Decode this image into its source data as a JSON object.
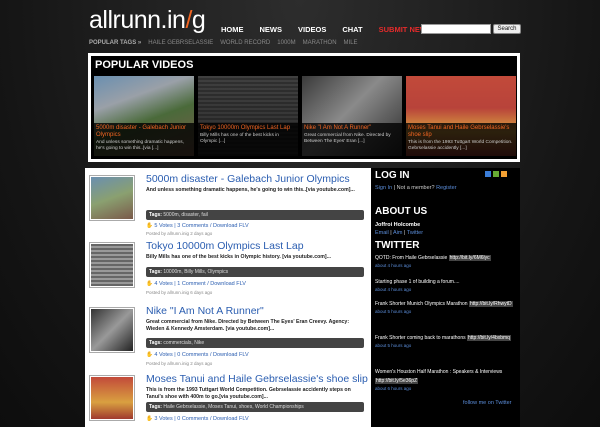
{
  "brand": {
    "logo_left": "allrunn.in",
    "logo_slash": "/",
    "logo_right": "g"
  },
  "nav": {
    "home": "HOME",
    "news": "NEWS",
    "videos": "VIDEOS",
    "chat": "CHAT",
    "submit": "SUBMIT NEW"
  },
  "search": {
    "button": "Search",
    "placeholder": ""
  },
  "popular_tags": {
    "label": "POPULAR TAGS »",
    "items": [
      "HAILE GEBRSELASSIE",
      "WORLD RECORD",
      "1000M",
      "MARATHON",
      "MILE"
    ]
  },
  "popular_videos": {
    "title": "POPULAR VIDEOS",
    "items": [
      {
        "title": "5000m disaster - Galebach Junior Olympics",
        "desc": "And unless something dramatic happens, he's going to win this..[via [...]"
      },
      {
        "title": "Tokyo 10000m Olympics Last Lap",
        "desc": "Billy Mills has one of the best kicks in Olympic [...]"
      },
      {
        "title": "Nike \"I Am Not A Runner\"",
        "desc": "Great commercial from Nike. Directed by Between The Eyes' Eran [...]"
      },
      {
        "title": "Moses Tanui and Haile Gebrselassie's shoe slip",
        "desc": "This is from the 1993 Tuttgart World Competition. Gebrselassie accidently [...]"
      }
    ]
  },
  "posts": [
    {
      "title": "5000m disaster - Galebach Junior Olympics",
      "desc": "And unless something dramatic happens, he's going to win this..[via youtube.com]...",
      "tags_label": "Tags:",
      "tags": "5000m, disaster, fail",
      "votes": "5 Votes",
      "comments": "3 Comments",
      "download": "Download FLV",
      "posted": "Posted by allrunn.inig 2 days ago"
    },
    {
      "title": "Tokyo 10000m Olympics Last Lap",
      "desc": "Billy Mills has one of the best kicks in Olympic history. [via youtube.com]...",
      "tags_label": "Tags:",
      "tags": "10000m, Billy Mills, Olympics",
      "votes": "4 Votes",
      "comments": "1 Comment",
      "download": "Download FLV",
      "posted": "Posted by allrunn.inig 6 days ago"
    },
    {
      "title": "Nike \"I Am Not A Runner\"",
      "desc": "Great commercial from Nike. Directed by Between The Eyes' Eran Creevy. Agency: Wieden & Kennedy Amsterdam. [via youtube.com]...",
      "tags_label": "Tags:",
      "tags": "commercials, Nike",
      "votes": "4 Votes",
      "comments": "0 Comments",
      "download": "Download FLV",
      "posted": "Posted by allrunn.inig 2 days ago"
    },
    {
      "title": "Moses Tanui and Haile Gebrselassie's shoe slip",
      "desc": "This is from the 1993 Tuttgart World Competition. Gebrselassie accidently steps on Tanui's shoe with 400m to go.[via youtube.com]...",
      "tags_label": "Tags:",
      "tags": "Haile Gebrselassie, Moses Tanui, shoes, World Championships",
      "votes": "3 Votes",
      "comments": "0 Comments",
      "download": "Download FLV",
      "posted": ""
    }
  ],
  "sidebar": {
    "login_title": "LOG IN",
    "sign_in": "Sign In",
    "not_member": "Not a member?",
    "register": "Register",
    "about_title": "ABOUT US",
    "about_name": "Joffroi Holcombe",
    "about_email": "Email",
    "about_aim": "Aim",
    "about_twitter": "Twitter",
    "twitter_title": "TWITTER",
    "follow": "follow me on Twitter",
    "tweets": [
      {
        "text": "QOTD: From Haile Gebrselassie",
        "url": "http://bit.ly/6M6lyc",
        "when": "about 4 hours ago"
      },
      {
        "text": "Starting phase 1 of building a forum....",
        "url": "",
        "when": "about 4 hours ago"
      },
      {
        "text": "Frank Shorter Munich Olympics Marathon",
        "url": "http://bit.ly/RhwytD",
        "when": "about 5 hours ago"
      },
      {
        "text": "Frank Shorter coming back to marathons",
        "url": "http://bit.ly/4bxbmq",
        "when": "about 5 hours ago"
      },
      {
        "text": "Women's Houston Half Marathon : Speakers & Interviews",
        "url": "http://bit.ly/5e36pZ",
        "when": "about 6 hours ago"
      }
    ]
  }
}
